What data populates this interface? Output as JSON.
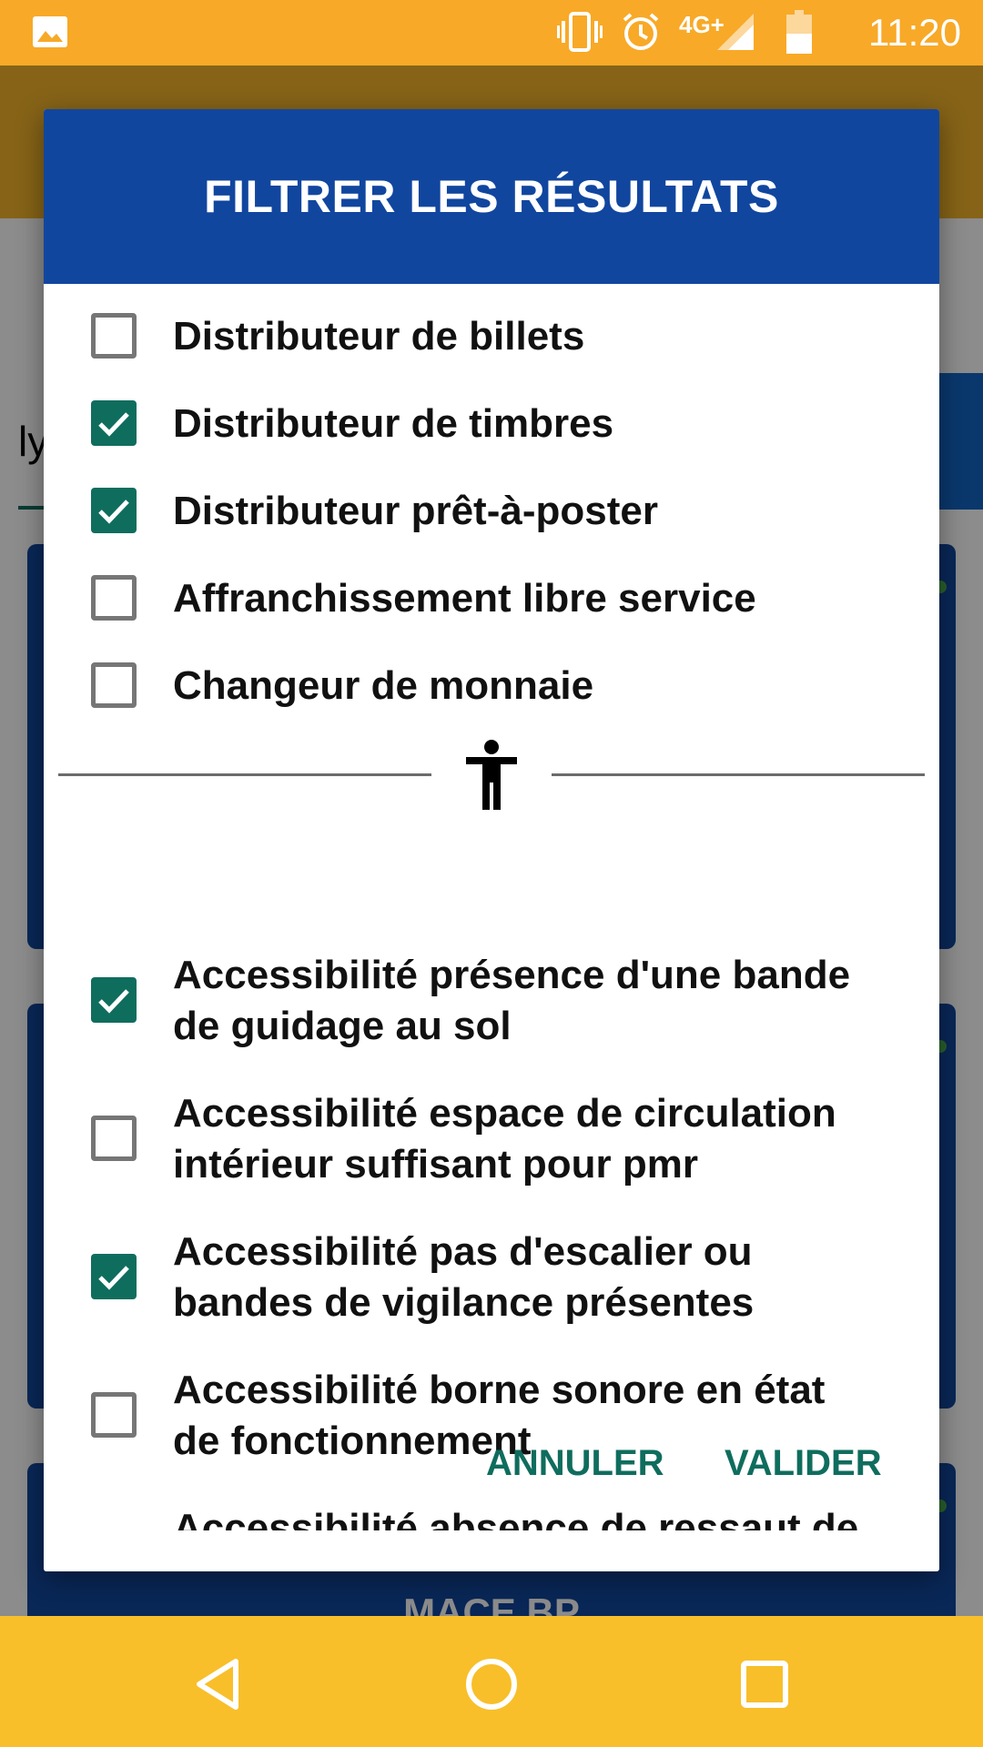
{
  "status_bar": {
    "time": "11:20",
    "network": "4G+",
    "icons": [
      "image-icon",
      "vibrate-icon",
      "alarm-icon",
      "signal-icon",
      "battery-icon"
    ]
  },
  "background": {
    "search_text": "ly",
    "card_title": "MACE BP"
  },
  "dialog": {
    "title": "FILTRER LES RÉSULTATS",
    "services": [
      {
        "label": "Distributeur de billets",
        "checked": false
      },
      {
        "label": "Distributeur de timbres",
        "checked": true
      },
      {
        "label": "Distributeur prêt-à-poster",
        "checked": true
      },
      {
        "label": "Affranchissement libre service",
        "checked": false
      },
      {
        "label": "Changeur de monnaie",
        "checked": false
      }
    ],
    "divider_icon": "accessibility-icon",
    "accessibility": [
      {
        "line1": "Accessibilité présence d'une bande",
        "line2": "de guidage au sol",
        "checked": true
      },
      {
        "line1": "Accessibilité espace de circulation",
        "line2": "intérieur suffisant pour pmr",
        "checked": false
      },
      {
        "line1": "Accessibilité pas d'escalier ou",
        "line2": "bandes de vigilance présentes",
        "checked": true
      },
      {
        "line1": "Accessibilité borne sonore en état",
        "line2": "de fonctionnement",
        "checked": false
      },
      {
        "line1": "Accessibilité absence de ressaut de",
        "line2": "",
        "checked": false
      }
    ],
    "cancel_label": "ANNULER",
    "ok_label": "VALIDER"
  },
  "colors": {
    "accent": "#0f6d5e",
    "header": "#11469f",
    "status_bar": "#f8a927",
    "nav_bar": "#f8bf2a"
  },
  "nav_bar": {
    "icons": [
      "back-icon",
      "home-icon",
      "recents-icon"
    ]
  }
}
